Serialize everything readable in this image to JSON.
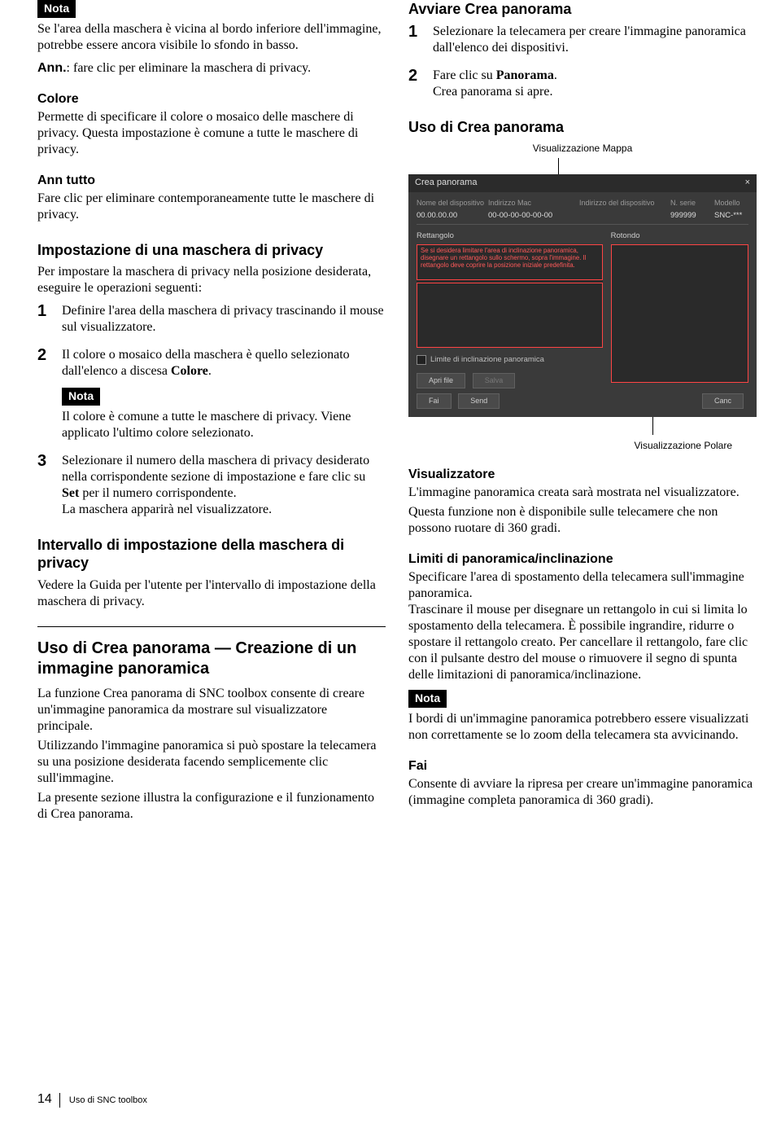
{
  "labels": {
    "nota": "Nota"
  },
  "left": {
    "nota1_p": "Se l'area della maschera è vicina al bordo inferiore dell'immagine, potrebbe essere ancora visibile lo sfondo in basso.",
    "ann_label": "Ann.",
    "ann_text": ": fare clic per eliminare la maschera di privacy.",
    "colore_h": "Colore",
    "colore_p": "Permette di specificare il colore o mosaico delle maschere di privacy. Questa impostazione è comune a tutte le maschere di privacy.",
    "anntutto_h": "Ann tutto",
    "anntutto_p": "Fare clic per eliminare contemporaneamente tutte le maschere di privacy.",
    "impost_h": "Impostazione di una maschera di privacy",
    "impost_p": "Per impostare la maschera di privacy nella posizione desiderata, eseguire le operazioni seguenti:",
    "step1": "Definire l'area della maschera di privacy trascinando il mouse sul visualizzatore.",
    "step2_a": "Il colore o mosaico della maschera è quello selezionato dall'elenco a discesa ",
    "step2_b": "Colore",
    "step2_c": ".",
    "nota2_p": "Il colore è comune a tutte le maschere di privacy. Viene applicato l'ultimo colore selezionato.",
    "step3_a": "Selezionare il numero della maschera di privacy desiderato nella corrispondente sezione di impostazione e fare clic su ",
    "step3_b": "Set",
    "step3_c": " per il numero corrispondente.",
    "step3_d": "La maschera apparirà nel visualizzatore.",
    "intervallo_h": "Intervallo di impostazione della maschera di privacy",
    "intervallo_p": "Vedere la Guida per l'utente per l'intervallo di impostazione della maschera di privacy.",
    "uso_h": "Uso di Crea panorama — Creazione di un immagine panoramica",
    "uso_p1": "La funzione Crea panorama di SNC toolbox consente di creare un'immagine panoramica da mostrare sul visualizzatore principale.",
    "uso_p2": "Utilizzando l'immagine panoramica si può spostare la telecamera su una posizione desiderata facendo semplicemente clic sull'immagine.",
    "uso_p3": "La presente sezione illustra la configurazione e il funzionamento di Crea panorama."
  },
  "right": {
    "avviare_h": "Avviare Crea panorama",
    "rstep1": "Selezionare la telecamera per creare l'immagine panoramica dall'elenco dei dispositivi.",
    "rstep2_a": "Fare clic su ",
    "rstep2_b": "Panorama",
    "rstep2_c": ".",
    "rstep2_d": "Crea panorama si apre.",
    "usocrea_h": "Uso di Crea panorama",
    "cap_top": "Visualizzazione Mappa",
    "cap_bot": "Visualizzazione Polare",
    "visual_h": "Visualizzatore",
    "visual_p1": "L'immagine panoramica creata sarà mostrata nel visualizzatore.",
    "visual_p2": "Questa funzione non è disponibile sulle telecamere che non possono ruotare di 360 gradi.",
    "limiti_h": "Limiti di panoramica/inclinazione",
    "limiti_p": "Specificare l'area di spostamento della telecamera sull'immagine panoramica.\nTrascinare il mouse per disegnare un rettangolo in cui si limita lo spostamento della telecamera. È possibile ingrandire, ridurre o spostare il rettangolo creato. Per cancellare il rettangolo, fare clic con il pulsante destro del mouse o rimuovere il segno di spunta delle limitazioni di panoramica/inclinazione.",
    "nota3_p": "I bordi di un'immagine panoramica potrebbero essere visualizzati non correttamente se lo zoom della telecamera sta avvicinando.",
    "fai_h": "Fai",
    "fai_p": "Consente di avviare la ripresa per creare un'immagine panoramica (immagine completa panoramica di 360 gradi)."
  },
  "dlg": {
    "title": "Crea panorama",
    "close": "×",
    "h1": "Nome del dispositivo",
    "h2": "Indirizzo Mac",
    "h3": "Indirizzo del dispositivo",
    "h4": "N. serie",
    "h5": "Modello",
    "r1": "00.00.00.00",
    "r2": "00-00-00-00-00-00",
    "r3": "",
    "r4": "999999",
    "r5": "SNC-***",
    "rett": "Rettangolo",
    "roto": "Rotondo",
    "redtxt": "Se si desidera limitare l'area di inclinazione panoramica, disegnare un rettangolo sullo schermo, sopra l'immagine. Il rettangolo deve coprire la posizione iniziale predefinita.",
    "chk": "Limite di inclinazione panoramica",
    "apri": "Apri file",
    "salva": "Salva",
    "fai": "Fai",
    "send": "Send",
    "canc": "Canc"
  },
  "footer": {
    "page": "14",
    "text": "Uso di SNC toolbox"
  }
}
